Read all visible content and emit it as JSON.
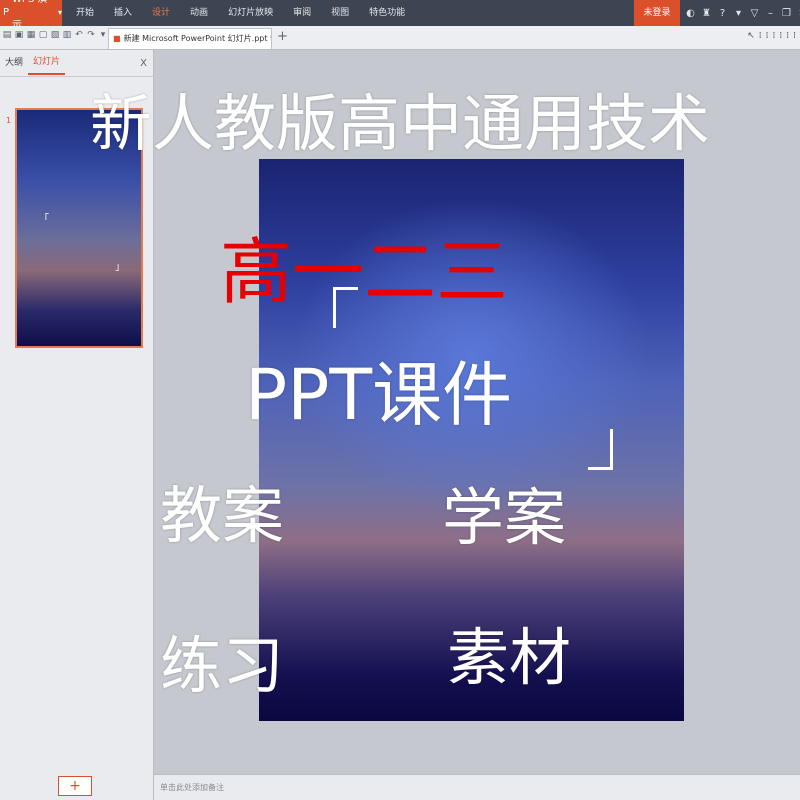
{
  "app": {
    "logo_label": "WPS 演示",
    "menu": [
      "开始",
      "插入",
      "设计",
      "动画",
      "幻灯片放映",
      "审阅",
      "视图",
      "特色功能"
    ],
    "active_menu_index": 2,
    "login_label": "未登录",
    "accent_color": "#d9502b"
  },
  "tabs": {
    "document_tab_label": "新建 Microsoft PowerPoint 幻灯片.ppt *",
    "new_tab_label": "+"
  },
  "panel": {
    "tab_outline": "大纲",
    "tab_slides": "幻灯片",
    "close_label": "X",
    "slide_number": "1",
    "add_label": "+"
  },
  "notes": {
    "placeholder": "单击此处添加备注"
  },
  "overlay": {
    "title": "新人教版高中通用技术",
    "grades": "高一二三",
    "ppt": "PPT课件",
    "word1": "教案",
    "word2": "学案",
    "word3": "练习",
    "word4": "素材"
  }
}
